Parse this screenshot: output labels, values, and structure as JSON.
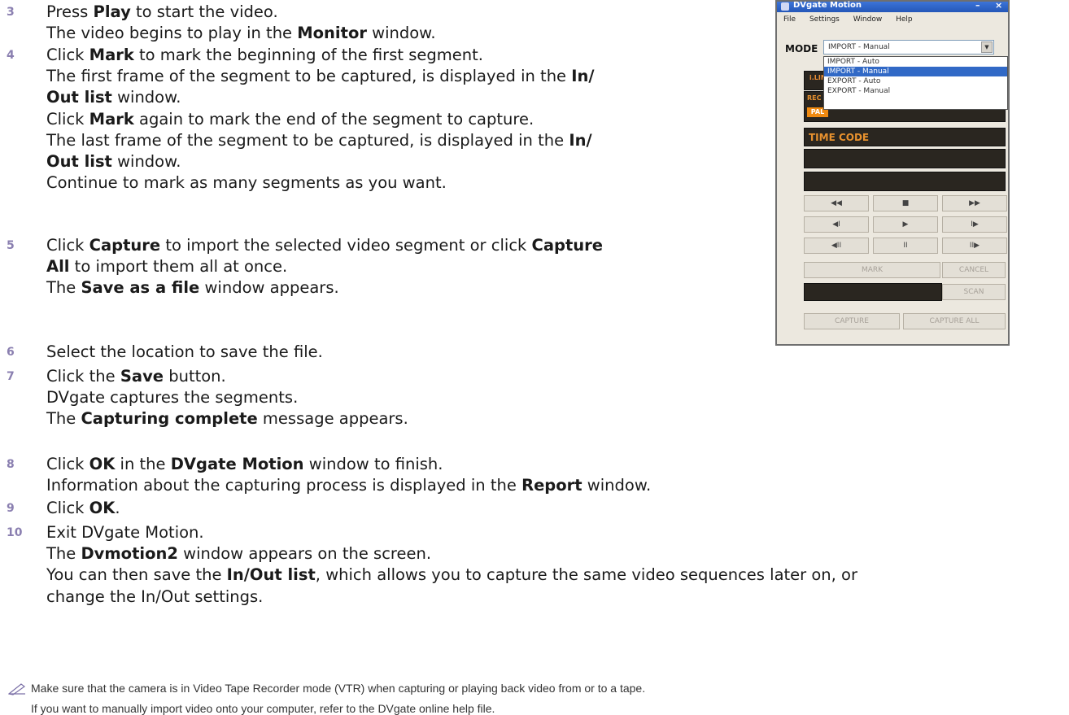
{
  "steps": [
    {
      "num": "3",
      "lines": [
        [
          {
            "t": "Press "
          },
          {
            "t": "Play",
            "b": true
          },
          {
            "t": " to start the video."
          }
        ],
        [
          {
            "t": "The video begins to play in the "
          },
          {
            "t": "Monitor",
            "b": true
          },
          {
            "t": " window."
          }
        ]
      ]
    },
    {
      "num": "4",
      "lines": [
        [
          {
            "t": "Click "
          },
          {
            "t": "Mark",
            "b": true
          },
          {
            "t": " to mark the beginning of the first segment."
          }
        ],
        [
          {
            "t": "The first frame of the segment to be captured, is displayed in the "
          },
          {
            "t": "In/",
            "b": true
          }
        ],
        [
          {
            "t": "Out list",
            "b": true
          },
          {
            "t": " window."
          }
        ],
        [
          {
            "t": "Click "
          },
          {
            "t": "Mark",
            "b": true
          },
          {
            "t": " again to mark the end of the segment to capture."
          }
        ],
        [
          {
            "t": "The last frame of the segment to be captured, is displayed in the "
          },
          {
            "t": "In/",
            "b": true
          }
        ],
        [
          {
            "t": "Out list",
            "b": true
          },
          {
            "t": " window."
          }
        ],
        [
          {
            "t": "Continue to mark as many segments as you want."
          }
        ]
      ]
    },
    {
      "num": "5",
      "lines": [
        [
          {
            "t": "Click "
          },
          {
            "t": "Capture",
            "b": true
          },
          {
            "t": " to import the selected video segment or click "
          },
          {
            "t": "Capture",
            "b": true
          }
        ],
        [
          {
            "t": "All",
            "b": true
          },
          {
            "t": " to import them all at once."
          }
        ],
        [
          {
            "t": "The "
          },
          {
            "t": "Save as a file",
            "b": true
          },
          {
            "t": " window appears."
          }
        ]
      ]
    },
    {
      "num": "6",
      "lines": [
        [
          {
            "t": "Select the location to save the file."
          }
        ]
      ]
    },
    {
      "num": "7",
      "lines": [
        [
          {
            "t": "Click the "
          },
          {
            "t": "Save",
            "b": true
          },
          {
            "t": " button."
          }
        ],
        [
          {
            "t": "DVgate captures the segments."
          }
        ],
        [
          {
            "t": "The "
          },
          {
            "t": "Capturing complete",
            "b": true
          },
          {
            "t": " message appears."
          }
        ]
      ]
    },
    {
      "num": "8",
      "lines": [
        [
          {
            "t": "Click "
          },
          {
            "t": "OK",
            "b": true
          },
          {
            "t": " in the "
          },
          {
            "t": "DVgate Motion",
            "b": true
          },
          {
            "t": " window to finish."
          }
        ],
        [
          {
            "t": "Information about the capturing process is displayed in the "
          },
          {
            "t": "Report",
            "b": true
          },
          {
            "t": " window."
          }
        ]
      ]
    },
    {
      "num": "9",
      "lines": [
        [
          {
            "t": "Click "
          },
          {
            "t": "OK",
            "b": true
          },
          {
            "t": "."
          }
        ]
      ]
    },
    {
      "num": "10",
      "lines": [
        [
          {
            "t": "Exit DVgate Motion."
          }
        ],
        [
          {
            "t": "The "
          },
          {
            "t": "Dvmotion2",
            "b": true
          },
          {
            "t": " window appears on the screen."
          }
        ],
        [
          {
            "t": "You can then save the "
          },
          {
            "t": "In/Out list",
            "b": true
          },
          {
            "t": ", which allows you to capture the same video sequences later on, or"
          }
        ],
        [
          {
            "t": "change the In/Out settings."
          }
        ]
      ]
    }
  ],
  "notes": [
    "Make sure that the camera is in Video Tape Recorder mode (VTR) when capturing or playing back video from or to a tape.",
    "If you want to manually import video onto your computer, refer to the DVgate online help file."
  ],
  "dvgate": {
    "title": "DVgate Motion",
    "menu": [
      "File",
      "Settings",
      "Window",
      "Help"
    ],
    "mode_label": "MODE",
    "mode_value": "IMPORT - Manual",
    "mode_options": [
      "IMPORT - Auto",
      "IMPORT - Manual",
      "EXPORT - Auto",
      "EXPORT - Manual"
    ],
    "selected_option_index": 1,
    "ilink_label": "i.LINK",
    "rec_label": "REC DAT",
    "pal_label": "PAL",
    "timecode_label": "TIME CODE",
    "transport": [
      "◀◀",
      "■",
      "▶▶",
      "◀I",
      "▶",
      "I▶",
      "◀II",
      "II",
      "II▶"
    ],
    "mark_label": "MARK",
    "cancel_label": "CANCEL",
    "scan_label": "SCAN",
    "capture_label": "CAPTURE",
    "capture_all_label": "CAPTURE ALL"
  }
}
